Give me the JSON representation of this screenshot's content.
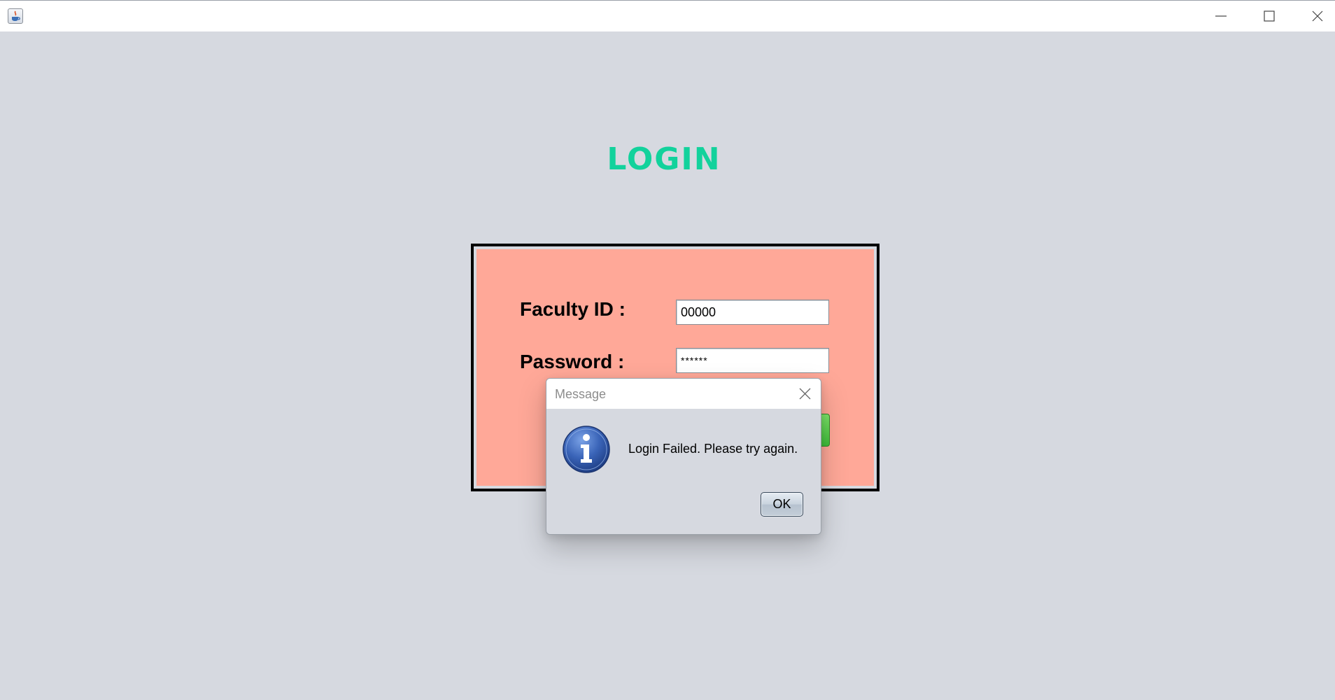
{
  "window": {
    "icons": {
      "app": "java-app-icon",
      "minimize": "minimize-icon",
      "maximize": "maximize-icon",
      "close": "close-icon"
    }
  },
  "login": {
    "title": "LOGIN",
    "faculty_id_label": "Faculty ID :",
    "faculty_id_value": "00000",
    "password_label": "Password :",
    "password_value": "******"
  },
  "dialog": {
    "title": "Message",
    "message": "Login Failed. Please try again.",
    "ok_label": "OK",
    "icon": "info-icon"
  },
  "colors": {
    "background": "#d6d9e0",
    "title_accent": "#12d29c",
    "panel": "#ffa898",
    "panel_border": "#000000",
    "login_button": "#4ccc40",
    "info_icon": "#2f56a8"
  }
}
